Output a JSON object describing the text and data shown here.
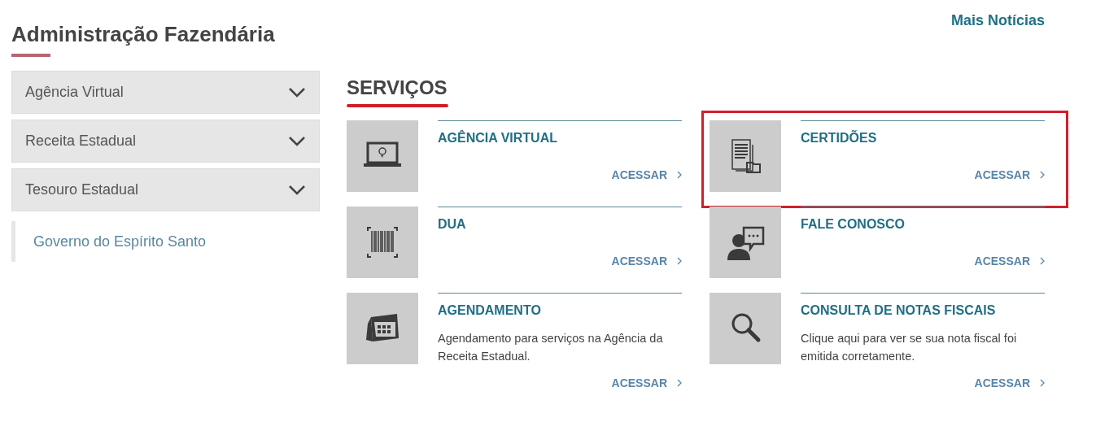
{
  "sidebar": {
    "title": "Administração Fazendária",
    "items": [
      {
        "label": "Agência Virtual",
        "expanded": false
      },
      {
        "label": "Receita Estadual",
        "expanded": false
      },
      {
        "label": "Tesouro Estadual",
        "expanded": false
      }
    ],
    "link": "Governo do Espírito Santo"
  },
  "news_link": "Mais Notícias",
  "services": {
    "title": "SERVIÇOS",
    "cards": [
      {
        "title": "AGÊNCIA VIRTUAL",
        "action": "ACESSAR",
        "highlighted": false
      },
      {
        "title": "CERTIDÕES",
        "action": "ACESSAR",
        "highlighted": true
      },
      {
        "title": "DUA",
        "action": "ACESSAR",
        "highlighted": false
      },
      {
        "title": "FALE CONOSCO",
        "action": "ACESSAR",
        "highlighted": false
      },
      {
        "title": "AGENDAMENTO",
        "description": "Agendamento para serviços na Agência da Receita Estadual.",
        "action": "ACESSAR",
        "highlighted": false
      },
      {
        "title": "CONSULTA DE NOTAS FISCAIS",
        "description": "Clique aqui para ver se sua nota fiscal foi emitida corretamente.",
        "action": "ACESSAR",
        "highlighted": false
      }
    ]
  }
}
